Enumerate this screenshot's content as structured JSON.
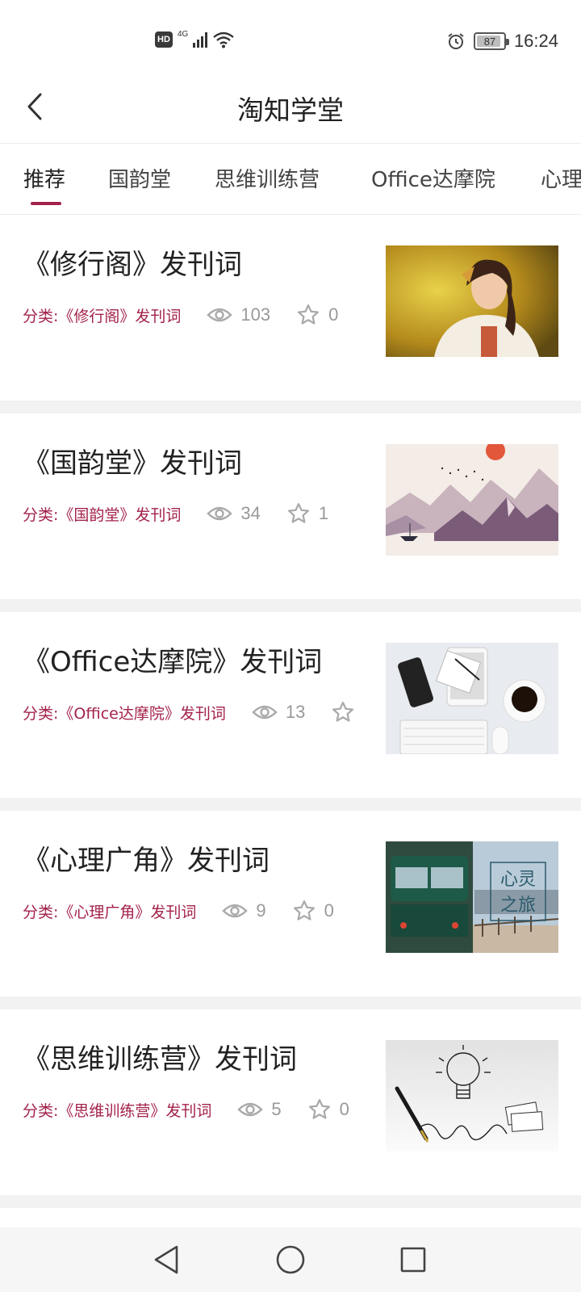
{
  "status_bar": {
    "hd_badge": "HD",
    "network": "4G",
    "battery_level": "87",
    "time": "16:24"
  },
  "header": {
    "title": "淘知学堂"
  },
  "tabs": [
    {
      "label": "推荐",
      "active": true
    },
    {
      "label": "国韵堂",
      "active": false
    },
    {
      "label": "思维训练营",
      "active": false
    },
    {
      "label": "Office达摩院",
      "active": false
    },
    {
      "label": "心理",
      "active": false
    }
  ],
  "articles": [
    {
      "title": "《修行阁》发刊词",
      "category": "分类:《修行阁》发刊词",
      "views": "103",
      "favorites": "0",
      "thumbnail": "portrait-woman-autumn"
    },
    {
      "title": "《国韵堂》发刊词",
      "category": "分类:《国韵堂》发刊词",
      "views": "34",
      "favorites": "1",
      "thumbnail": "ink-landscape-mountains"
    },
    {
      "title": "《Office达摩院》发刊词",
      "category": "分类:《Office达摩院》发刊词",
      "views": "13",
      "favorites": "",
      "thumbnail": "desk-keyboard-phone-coffee"
    },
    {
      "title": "《心理广角》发刊词",
      "category": "分类:《心理广角》发刊词",
      "views": "9",
      "favorites": "0",
      "thumbnail": "train-psychology-journey",
      "thumbnail_text": [
        "心灵",
        "之旅"
      ]
    },
    {
      "title": "《思维训练营》发刊词",
      "category": "分类:《思维训练营》发刊词",
      "views": "5",
      "favorites": "0",
      "thumbnail": "lightbulb-pen-idea"
    }
  ],
  "colors": {
    "accent": "#a3224a",
    "muted": "#999999",
    "divider": "#f2f2f2"
  }
}
